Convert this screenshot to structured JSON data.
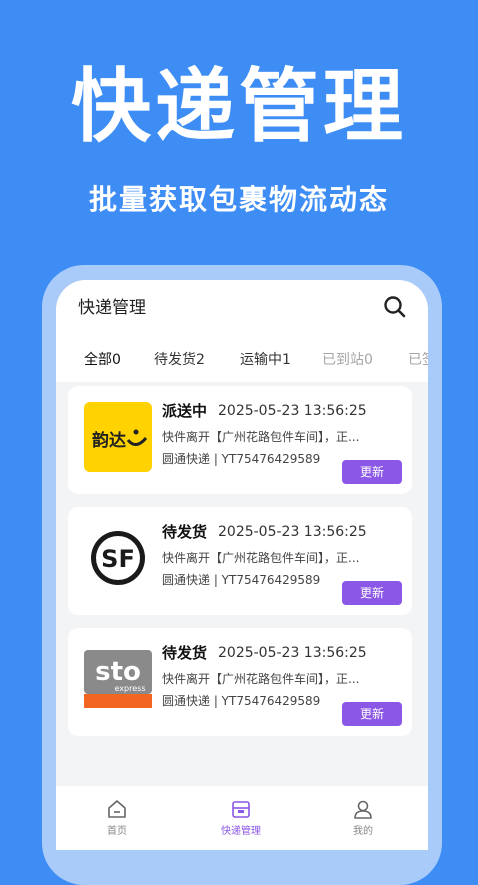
{
  "hero": {
    "title": "快递管理",
    "subtitle": "批量获取包裹物流动态"
  },
  "header": {
    "title": "快递管理",
    "search_icon": "search-icon"
  },
  "tabs": [
    {
      "label": "全部0"
    },
    {
      "label": "待发货2"
    },
    {
      "label": "运输中1"
    },
    {
      "label": "已到站0"
    },
    {
      "label": "已签"
    }
  ],
  "packages": [
    {
      "logo": "yunda-logo",
      "logo_text": "韵达",
      "status": "派送中",
      "time": "2025-05-23 13:56:25",
      "description": "快件离开【广州花路包件车间】，正...",
      "courier_tracking": "圆通快递 | YT75476429589",
      "button": "更新"
    },
    {
      "logo": "sf-logo",
      "logo_text": "SF",
      "status": "待发货",
      "time": "2025-05-23 13:56:25",
      "description": "快件离开【广州花路包件车间】，正...",
      "courier_tracking": "圆通快递 | YT75476429589",
      "button": "更新"
    },
    {
      "logo": "sto-logo",
      "logo_text": "sto",
      "logo_subtext": "express",
      "status": "待发货",
      "time": "2025-05-23 13:56:25",
      "description": "快件离开【广州花路包件车间】，正...",
      "courier_tracking": "圆通快递 | YT75476429589",
      "button": "更新"
    }
  ],
  "bottom_nav": [
    {
      "label": "首页",
      "icon": "home-icon"
    },
    {
      "label": "快递管理",
      "icon": "package-icon"
    },
    {
      "label": "我的",
      "icon": "user-icon"
    }
  ],
  "colors": {
    "background": "#3d8df5",
    "accent": "#8b57e6",
    "yunda": "#ffd200",
    "sto_orange": "#f26522"
  }
}
